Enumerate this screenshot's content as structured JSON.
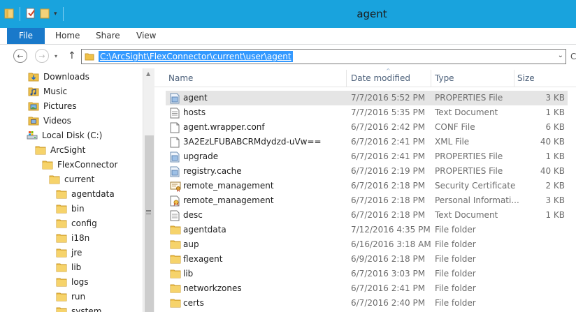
{
  "window": {
    "title": "agent"
  },
  "ribbon": {
    "tabs": [
      "File",
      "Home",
      "Share",
      "View"
    ]
  },
  "address": {
    "path": "C:\\ArcSight\\FlexConnector\\current\\user\\agent"
  },
  "nav_tree": [
    {
      "label": "Downloads",
      "icon": "downloads-folder-icon"
    },
    {
      "label": "Music",
      "icon": "music-folder-icon"
    },
    {
      "label": "Pictures",
      "icon": "pictures-folder-icon"
    },
    {
      "label": "Videos",
      "icon": "videos-folder-icon"
    },
    {
      "label": "Local Disk (C:)",
      "icon": "local-disk-icon"
    },
    {
      "label": "ArcSight",
      "icon": "folder-icon"
    },
    {
      "label": "FlexConnector",
      "icon": "folder-icon"
    },
    {
      "label": "current",
      "icon": "folder-icon"
    },
    {
      "label": "agentdata",
      "icon": "folder-icon"
    },
    {
      "label": "bin",
      "icon": "folder-icon"
    },
    {
      "label": "config",
      "icon": "folder-icon"
    },
    {
      "label": "i18n",
      "icon": "folder-icon"
    },
    {
      "label": "jre",
      "icon": "folder-icon"
    },
    {
      "label": "lib",
      "icon": "folder-icon"
    },
    {
      "label": "logs",
      "icon": "folder-icon"
    },
    {
      "label": "run",
      "icon": "folder-icon"
    },
    {
      "label": "system",
      "icon": "folder-icon"
    }
  ],
  "columns": {
    "name": "Name",
    "date": "Date modified",
    "type": "Type",
    "size": "Size"
  },
  "files": [
    {
      "name": "agent",
      "date": "7/7/2016 5:52 PM",
      "type": "PROPERTIES File",
      "size": "3 KB",
      "icon": "properties-file-icon"
    },
    {
      "name": "hosts",
      "date": "7/7/2016 5:35 PM",
      "type": "Text Document",
      "size": "1 KB",
      "icon": "text-document-icon"
    },
    {
      "name": "agent.wrapper.conf",
      "date": "6/7/2016 2:42 PM",
      "type": "CONF File",
      "size": "6 KB",
      "icon": "blank-file-icon"
    },
    {
      "name": "3A2EzLFUBABCRMdydzd-uVw==",
      "date": "6/7/2016 2:41 PM",
      "type": "XML File",
      "size": "40 KB",
      "icon": "blank-file-icon"
    },
    {
      "name": "upgrade",
      "date": "6/7/2016 2:41 PM",
      "type": "PROPERTIES File",
      "size": "1 KB",
      "icon": "properties-file-icon"
    },
    {
      "name": "registry.cache",
      "date": "6/7/2016 2:19 PM",
      "type": "PROPERTIES File",
      "size": "40 KB",
      "icon": "properties-file-icon"
    },
    {
      "name": "remote_management",
      "date": "6/7/2016 2:18 PM",
      "type": "Security Certificate",
      "size": "2 KB",
      "icon": "certificate-icon"
    },
    {
      "name": "remote_management",
      "date": "6/7/2016 2:18 PM",
      "type": "Personal Informati...",
      "size": "3 KB",
      "icon": "personal-information-icon"
    },
    {
      "name": "desc",
      "date": "6/7/2016 2:18 PM",
      "type": "Text Document",
      "size": "1 KB",
      "icon": "text-document-icon"
    },
    {
      "name": "agentdata",
      "date": "7/12/2016 4:35 PM",
      "type": "File folder",
      "size": "",
      "icon": "folder-icon"
    },
    {
      "name": "aup",
      "date": "6/16/2016 3:18 AM",
      "type": "File folder",
      "size": "",
      "icon": "folder-icon"
    },
    {
      "name": "flexagent",
      "date": "6/9/2016 2:18 PM",
      "type": "File folder",
      "size": "",
      "icon": "folder-icon"
    },
    {
      "name": "lib",
      "date": "6/7/2016 3:03 PM",
      "type": "File folder",
      "size": "",
      "icon": "folder-icon"
    },
    {
      "name": "networkzones",
      "date": "6/7/2016 2:41 PM",
      "type": "File folder",
      "size": "",
      "icon": "folder-icon"
    },
    {
      "name": "certs",
      "date": "6/7/2016 2:40 PM",
      "type": "File folder",
      "size": "",
      "icon": "folder-icon"
    }
  ],
  "colors": {
    "titlebar": "#19a3dd",
    "file_tab": "#1979ca",
    "selection": "#3399ff",
    "folder": "#f0c24a"
  }
}
